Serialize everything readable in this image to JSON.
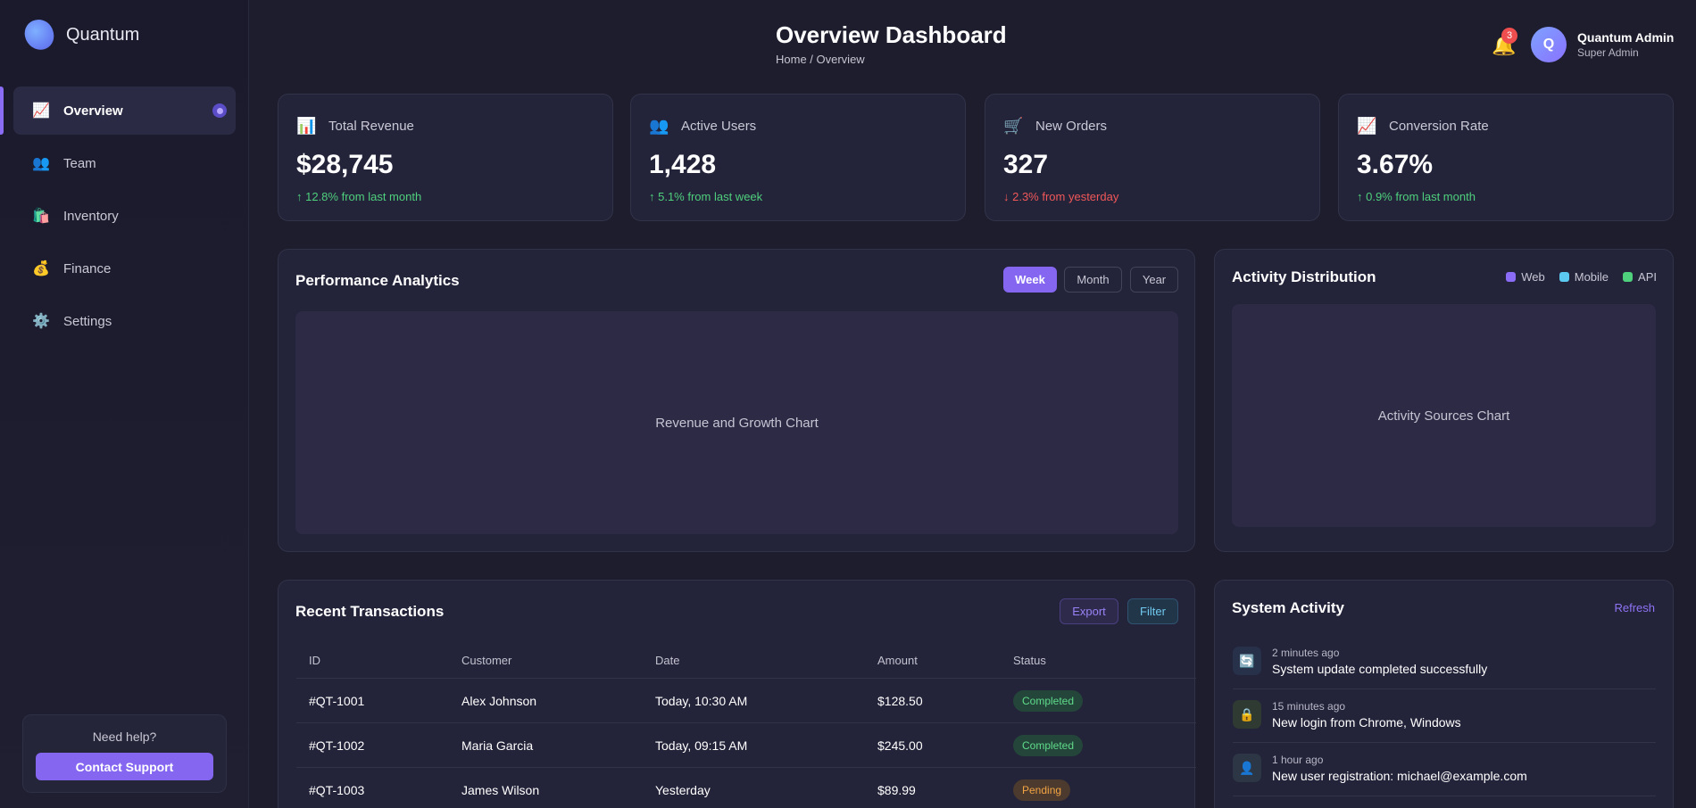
{
  "brand": {
    "name": "Quantum"
  },
  "sidebar": {
    "items": [
      {
        "label": "Overview",
        "icon": "📈",
        "active": true
      },
      {
        "label": "Team",
        "icon": "👥"
      },
      {
        "label": "Inventory",
        "icon": "🛍️"
      },
      {
        "label": "Finance",
        "icon": "💰"
      },
      {
        "label": "Settings",
        "icon": "⚙️"
      }
    ],
    "help": {
      "text": "Need help?",
      "button": "Contact Support"
    }
  },
  "header": {
    "title": "Overview Dashboard",
    "breadcrumb": "Home / Overview",
    "notifications": "3",
    "user": {
      "initial": "Q",
      "name": "Quantum Admin",
      "role": "Super Admin"
    }
  },
  "stats": [
    {
      "icon": "📊",
      "label": "Total Revenue",
      "value": "$28,745",
      "change": "↑ 12.8% from last month",
      "trend": "up"
    },
    {
      "icon": "👥",
      "label": "Active Users",
      "value": "1,428",
      "change": "↑ 5.1% from last week",
      "trend": "up"
    },
    {
      "icon": "🛒",
      "label": "New Orders",
      "value": "327",
      "change": "↓ 2.3% from yesterday",
      "trend": "down"
    },
    {
      "icon": "📈",
      "label": "Conversion Rate",
      "value": "3.67%",
      "change": "↑ 0.9% from last month",
      "trend": "up"
    }
  ],
  "performance": {
    "title": "Performance Analytics",
    "periods": [
      "Week",
      "Month",
      "Year"
    ],
    "selected_period": "Week",
    "placeholder": "Revenue and Growth Chart"
  },
  "activity_distribution": {
    "title": "Activity Distribution",
    "legend": [
      {
        "label": "Web",
        "color": "#8a6cf6"
      },
      {
        "label": "Mobile",
        "color": "#5cc9f0"
      },
      {
        "label": "API",
        "color": "#4fd07c"
      }
    ],
    "placeholder": "Activity Sources Chart"
  },
  "transactions": {
    "title": "Recent Transactions",
    "export_label": "Export",
    "filter_label": "Filter",
    "columns": [
      "ID",
      "Customer",
      "Date",
      "Amount",
      "Status"
    ],
    "rows": [
      {
        "id": "#QT-1001",
        "customer": "Alex Johnson",
        "date": "Today, 10:30 AM",
        "amount": "$128.50",
        "status": "Completed"
      },
      {
        "id": "#QT-1002",
        "customer": "Maria Garcia",
        "date": "Today, 09:15 AM",
        "amount": "$245.00",
        "status": "Completed"
      },
      {
        "id": "#QT-1003",
        "customer": "James Wilson",
        "date": "Yesterday",
        "amount": "$89.99",
        "status": "Pending"
      }
    ]
  },
  "system_activity": {
    "title": "System Activity",
    "refresh_label": "Refresh",
    "items": [
      {
        "icon": "🔄",
        "icon_name": "sync-icon",
        "time": "2 minutes ago",
        "text": "System update completed successfully"
      },
      {
        "icon": "🔒",
        "icon_name": "lock-icon",
        "time": "15 minutes ago",
        "text": "New login from Chrome, Windows"
      },
      {
        "icon": "👤",
        "icon_name": "user-icon",
        "time": "1 hour ago",
        "text": "New user registration: michael@example.com"
      }
    ]
  },
  "colors": {
    "accent": "#8466f1",
    "positive": "#4fd07c",
    "negative": "#f05858",
    "pending": "#f2a344"
  }
}
